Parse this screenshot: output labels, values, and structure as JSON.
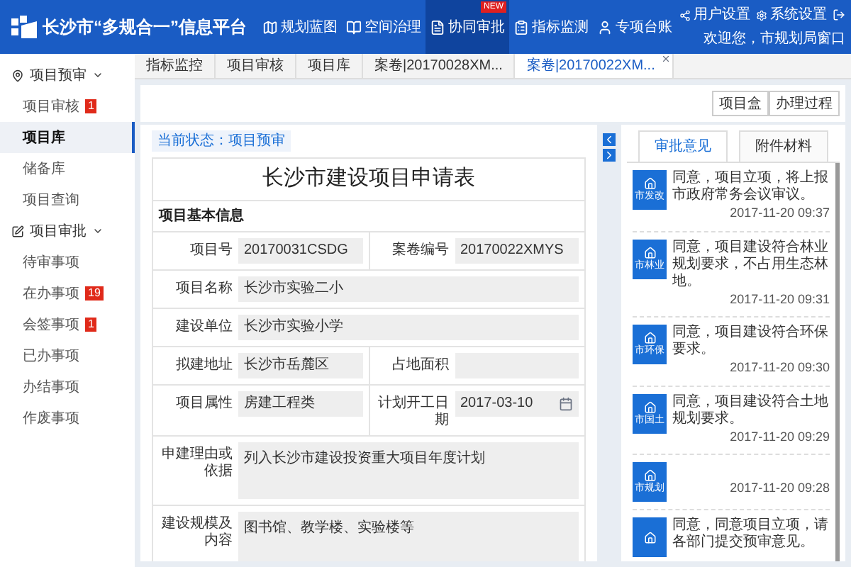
{
  "header": {
    "title": "长沙市“多规合一”信息平台",
    "nav": [
      {
        "label": "规划蓝图",
        "selected": false
      },
      {
        "label": "空间治理",
        "selected": false
      },
      {
        "label": "协同审批",
        "selected": true,
        "badge": "NEW"
      },
      {
        "label": "指标监测",
        "selected": false
      },
      {
        "label": "专项台账",
        "selected": false
      }
    ],
    "user_links": [
      "用户设置",
      "系统设置"
    ],
    "welcome": "欢迎您，市规划局窗口"
  },
  "sidebar": {
    "sections": [
      {
        "label": "项目预审",
        "expanded": true,
        "items": [
          {
            "label": "项目审核",
            "selected": false,
            "badge": "1"
          },
          {
            "label": "项目库",
            "selected": true
          },
          {
            "label": "储备库",
            "selected": false
          },
          {
            "label": "项目查询",
            "selected": false
          }
        ]
      },
      {
        "label": "项目审批",
        "expanded": true,
        "items": [
          {
            "label": "待审事项",
            "selected": false
          },
          {
            "label": "在办事项",
            "selected": false,
            "badge": "19"
          },
          {
            "label": "会签事项",
            "selected": false,
            "badge": "1"
          },
          {
            "label": "已办事项",
            "selected": false
          },
          {
            "label": "办结事项",
            "selected": false
          },
          {
            "label": "作废事项",
            "selected": false
          }
        ]
      }
    ]
  },
  "tabs": [
    {
      "label": "指标监控",
      "selected": false
    },
    {
      "label": "项目审核",
      "selected": false
    },
    {
      "label": "项目库",
      "selected": false
    },
    {
      "label": "案卷|20170028XM...",
      "selected": false
    },
    {
      "label": "案卷|20170022XM...",
      "selected": true
    }
  ],
  "toolbar_buttons": [
    "项目盒",
    "办理过程"
  ],
  "status": "当前状态：项目预审",
  "form": {
    "title": "长沙市建设项目申请表",
    "section": "项目基本信息",
    "rows": [
      {
        "fields": [
          {
            "label": "项目号",
            "value": "20170031CSDG",
            "kind": "text"
          },
          {
            "label": "案卷编号",
            "value": "20170022XMYS",
            "kind": "text"
          }
        ]
      },
      {
        "fields": [
          {
            "label": "项目名称",
            "value": "长沙市实验二小",
            "kind": "text"
          }
        ]
      },
      {
        "fields": [
          {
            "label": "建设单位",
            "value": "长沙市实验小学",
            "kind": "text"
          }
        ]
      },
      {
        "fields": [
          {
            "label": "拟建地址",
            "value": "长沙市岳麓区",
            "kind": "text"
          },
          {
            "label": "占地面积",
            "kind": "text"
          }
        ]
      },
      {
        "fields": [
          {
            "label": "项目属性",
            "value": "房建工程类",
            "kind": "text"
          },
          {
            "label": "计划开工日期",
            "value": "2017-03-10",
            "kind": "date"
          }
        ]
      },
      {
        "fields": [
          {
            "label": "申建理由或依据",
            "value": "列入长沙市建设投资重大项目年度计划",
            "kind": "textarea"
          }
        ]
      },
      {
        "fields": [
          {
            "label": "建设规模及内容",
            "value": "图书馆、教学楼、实验楼等",
            "kind": "textarea"
          }
        ]
      }
    ]
  },
  "opinions": {
    "tabs": [
      {
        "label": "审批意见",
        "selected": true
      },
      {
        "label": "附件材料",
        "selected": false
      }
    ],
    "items": [
      {
        "dept": "市发改",
        "text": "同意，项目立项，将上报市政府常务会议审议。",
        "time": "2017-11-20 09:37"
      },
      {
        "dept": "市林业",
        "text": "同意，项目建设符合林业规划要求，不占用生态林地。",
        "time": "2017-11-20 09:31"
      },
      {
        "dept": "市环保",
        "text": "同意，项目建设符合环保要求。",
        "time": "2017-11-20 09:30"
      },
      {
        "dept": "市国土",
        "text": "同意，项目建设符合土地规划要求。",
        "time": "2017-11-20 09:29"
      },
      {
        "dept": "市规划",
        "time": "2017-11-20 09:28"
      },
      {
        "text": "同意，同意项目立项，请各部门提交预审意见。"
      }
    ]
  }
}
